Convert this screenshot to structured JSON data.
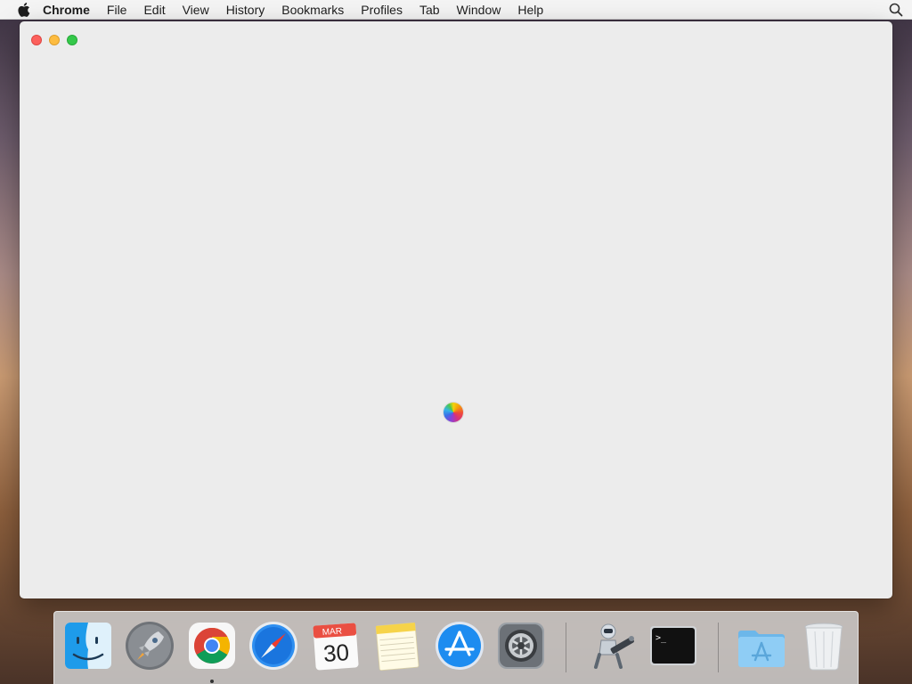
{
  "menubar": {
    "app_name": "Chrome",
    "items": [
      "File",
      "Edit",
      "View",
      "History",
      "Bookmarks",
      "Profiles",
      "Tab",
      "Window",
      "Help"
    ],
    "icons": {
      "apple": "apple-icon",
      "spotlight": "search-icon"
    }
  },
  "window": {
    "state": "loading",
    "spinner_icon": "spinning-wait-cursor-icon"
  },
  "dock": {
    "apps": [
      {
        "name": "Finder",
        "icon": "finder-icon",
        "running": false
      },
      {
        "name": "Launchpad",
        "icon": "launchpad-icon",
        "running": false
      },
      {
        "name": "Google Chrome",
        "icon": "chrome-icon",
        "running": true
      },
      {
        "name": "Safari",
        "icon": "safari-icon",
        "running": false
      },
      {
        "name": "Calendar",
        "icon": "calendar-icon",
        "running": false
      },
      {
        "name": "Notes",
        "icon": "notes-icon",
        "running": false
      },
      {
        "name": "App Store",
        "icon": "app-store-icon",
        "running": false
      },
      {
        "name": "System Preferences",
        "icon": "system-preferences-icon",
        "running": false
      },
      {
        "name": "Automator",
        "icon": "automator-icon",
        "running": false
      },
      {
        "name": "Terminal",
        "icon": "terminal-icon",
        "running": false
      },
      {
        "name": "Applications",
        "icon": "applications-folder-icon",
        "running": false
      },
      {
        "name": "Trash",
        "icon": "trash-icon",
        "running": false
      }
    ],
    "calendar": {
      "month": "MAR",
      "day": "30"
    },
    "terminal_prompt": ">_"
  },
  "colors": {
    "close": "#fc605c",
    "minimize": "#fdbc40",
    "maximize": "#34c84a",
    "window_bg": "#ececec"
  }
}
